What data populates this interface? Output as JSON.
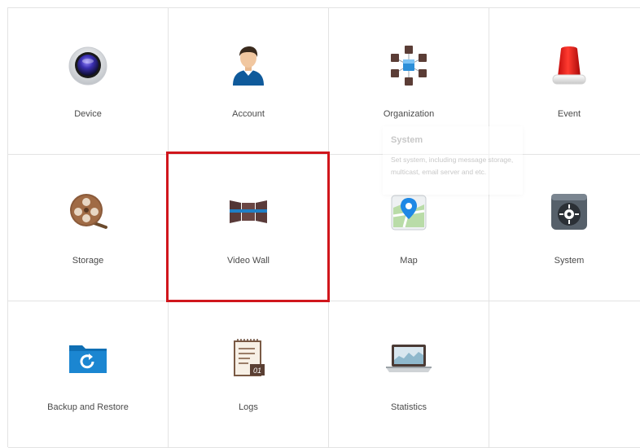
{
  "tiles": [
    {
      "label": "Device",
      "icon": "camera-lens-icon"
    },
    {
      "label": "Account",
      "icon": "user-avatar-icon"
    },
    {
      "label": "Organization",
      "icon": "organization-cubes-icon"
    },
    {
      "label": "Event",
      "icon": "alarm-siren-icon"
    },
    {
      "label": "Storage",
      "icon": "film-reel-icon"
    },
    {
      "label": "Video Wall",
      "icon": "video-wall-icon"
    },
    {
      "label": "Map",
      "icon": "map-pin-icon"
    },
    {
      "label": "System",
      "icon": "system-gauge-icon"
    },
    {
      "label": "Backup and Restore",
      "icon": "backup-folder-icon"
    },
    {
      "label": "Logs",
      "icon": "log-document-icon"
    },
    {
      "label": "Statistics",
      "icon": "laptop-chart-icon"
    }
  ],
  "selected_tile": "Video Wall",
  "tooltip": {
    "title": "System",
    "description": "Set system, including message storage, multicast, email server and etc."
  },
  "colors": {
    "selection_border": "#d0161c",
    "grid_line": "#e3e3e3",
    "label_text": "#4a4a4a"
  }
}
